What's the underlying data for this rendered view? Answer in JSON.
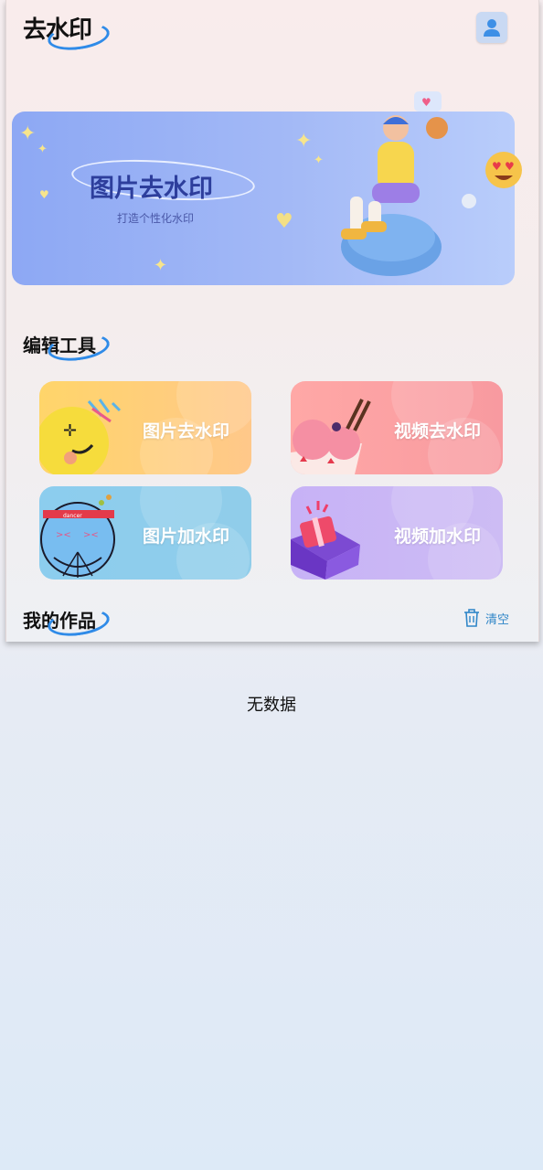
{
  "header": {
    "title": "去水印",
    "avatar_icon": "user-icon"
  },
  "banner": {
    "title": "图片去水印",
    "subtitle": "打造个性化水印"
  },
  "tools_section": {
    "title": "编辑工具",
    "items": [
      {
        "label": "图片去水印",
        "icon": "smiley-icon",
        "color": "#ffd56a"
      },
      {
        "label": "视频去水印",
        "icon": "icecream-icon",
        "color": "#ffa8a6"
      },
      {
        "label": "图片加水印",
        "icon": "dancer-icon",
        "color": "#8ccdee"
      },
      {
        "label": "视频加水印",
        "icon": "giftbox-icon",
        "color": "#c7b2f6"
      }
    ]
  },
  "works_section": {
    "title": "我的作品",
    "clear_label": "清空",
    "clear_icon": "trash-icon",
    "empty_text": "无数据"
  },
  "colors": {
    "accent": "#2f8be8",
    "banner_title": "#2d3e9c"
  }
}
